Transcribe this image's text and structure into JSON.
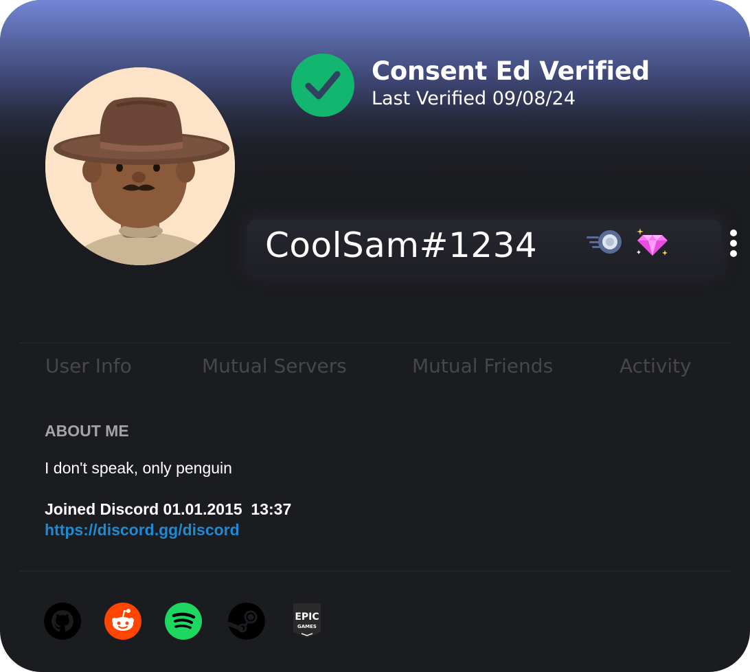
{
  "verification": {
    "title": "Consent Ed Verified",
    "date_text": "Last Verified 09/08/24",
    "badge_color": "#13b66e"
  },
  "profile": {
    "username": "CoolSam#1234",
    "avatar_icon": "cowboy-avatar",
    "badges": [
      "nitro-boost-icon",
      "gem-icon"
    ],
    "menu_icon": "more-vertical-icon"
  },
  "tabs": [
    {
      "label": "User Info"
    },
    {
      "label": "Mutual Servers"
    },
    {
      "label": "Mutual Friends"
    },
    {
      "label": "Activity"
    }
  ],
  "about": {
    "heading": "ABOUT ME",
    "text": "I don't speak, only penguin",
    "joined": "Joined Discord 01.01.2015  13:37",
    "link": "https://discord.gg/discord"
  },
  "socials": [
    {
      "icon": "github-icon",
      "color": "#000000"
    },
    {
      "icon": "reddit-icon",
      "color": "#ff4500"
    },
    {
      "icon": "spotify-icon",
      "color": "#1ed760"
    },
    {
      "icon": "steam-icon",
      "color": "#000000"
    },
    {
      "icon": "epic-games-icon",
      "color": "#2a2a2a",
      "text_top": "EPIC",
      "text_bottom": "GAMES"
    }
  ],
  "colors": {
    "card_bg": "#1b1c20",
    "banner_top": "#7386d8",
    "tab_text": "#45474d",
    "link": "#1f8ad2",
    "heading": "#a3a3a8"
  }
}
